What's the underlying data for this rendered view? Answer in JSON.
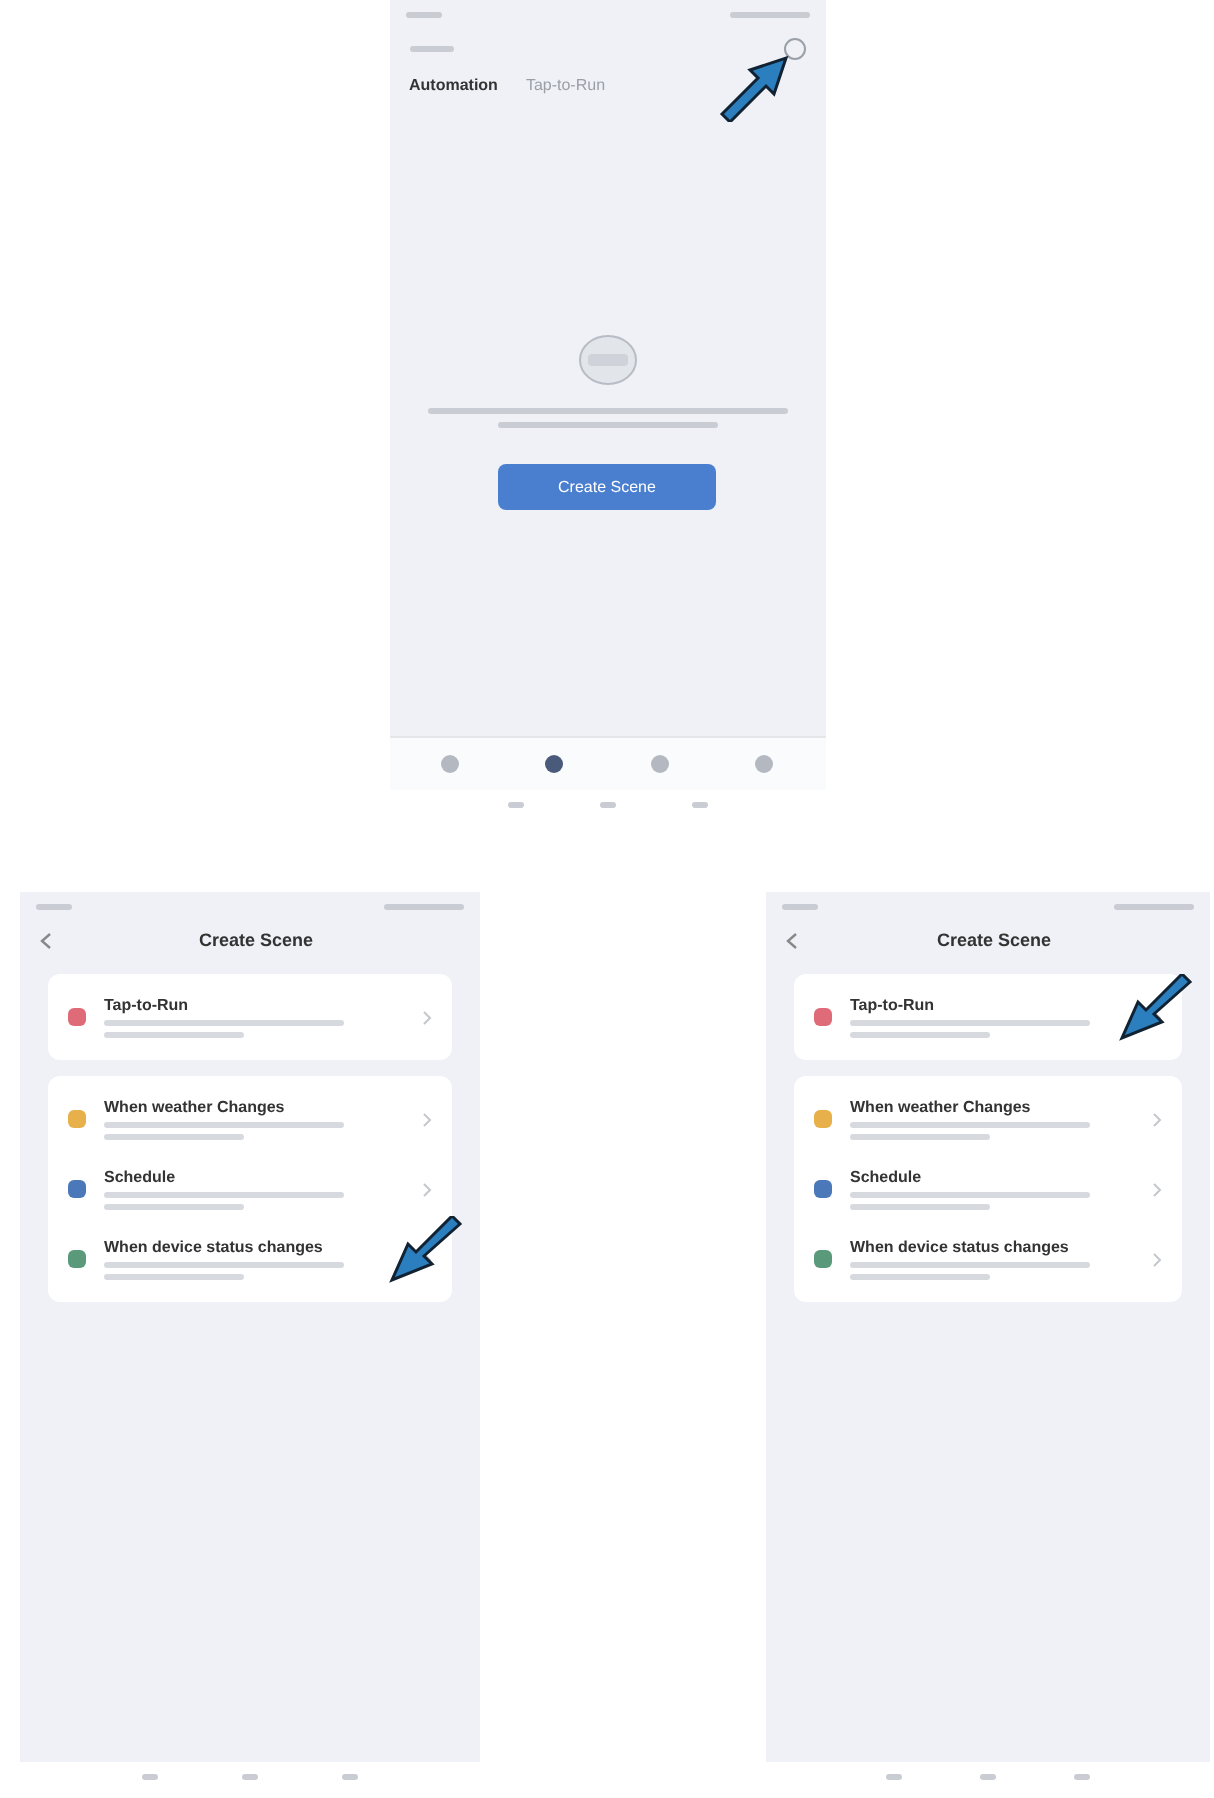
{
  "phones": [
    {
      "kind": "scenes",
      "add_button": {
        "pointed": true
      },
      "tabs": [
        {
          "label": "Automation",
          "selected": true
        },
        {
          "label": "Tap-to-Run",
          "selected": false
        }
      ],
      "create_button": "Create Scene",
      "nav": [
        {
          "selected": false
        },
        {
          "selected": true
        },
        {
          "selected": false
        },
        {
          "selected": false
        }
      ]
    },
    {
      "kind": "create",
      "title": "Create Scene",
      "groups": [
        [
          {
            "title": "Tap-to-Run",
            "color": "#e06b78",
            "pointed": false
          }
        ],
        [
          {
            "title": "When weather Changes",
            "color": "#e8b04a",
            "pointed": false
          },
          {
            "title": "Schedule",
            "color": "#4a78b8",
            "pointed": false
          },
          {
            "title": "When device status changes",
            "color": "#5a9a7a",
            "pointed": true
          }
        ]
      ]
    },
    {
      "kind": "create",
      "title": "Create Scene",
      "groups": [
        [
          {
            "title": "Tap-to-Run",
            "color": "#e06b78",
            "pointed": true
          }
        ],
        [
          {
            "title": "When weather Changes",
            "color": "#e8b04a",
            "pointed": false
          },
          {
            "title": "Schedule",
            "color": "#4a78b8",
            "pointed": false
          },
          {
            "title": "When device status changes",
            "color": "#5a9a7a",
            "pointed": false
          }
        ]
      ]
    }
  ]
}
